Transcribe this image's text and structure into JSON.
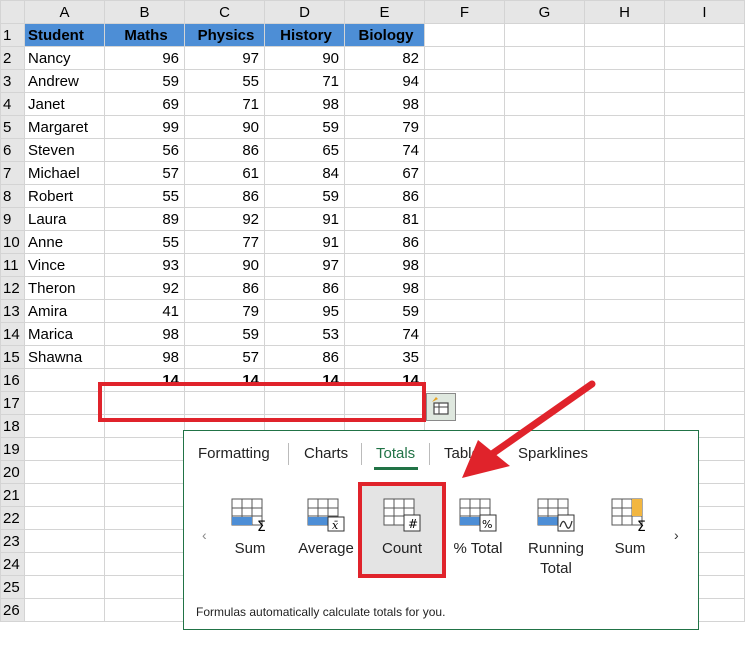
{
  "columns": [
    "A",
    "B",
    "C",
    "D",
    "E",
    "F",
    "G",
    "H",
    "I"
  ],
  "headers": [
    "Student",
    "Maths",
    "Physics",
    "History",
    "Biology"
  ],
  "rows": [
    {
      "name": "Nancy",
      "v": [
        "96",
        "97",
        "90",
        "82"
      ]
    },
    {
      "name": "Andrew",
      "v": [
        "59",
        "55",
        "71",
        "94"
      ]
    },
    {
      "name": "Janet",
      "v": [
        "69",
        "71",
        "98",
        "98"
      ]
    },
    {
      "name": "Margaret",
      "v": [
        "99",
        "90",
        "59",
        "79"
      ]
    },
    {
      "name": "Steven",
      "v": [
        "56",
        "86",
        "65",
        "74"
      ]
    },
    {
      "name": "Michael",
      "v": [
        "57",
        "61",
        "84",
        "67"
      ]
    },
    {
      "name": "Robert",
      "v": [
        "55",
        "86",
        "59",
        "86"
      ]
    },
    {
      "name": "Laura",
      "v": [
        "89",
        "92",
        "91",
        "81"
      ]
    },
    {
      "name": "Anne",
      "v": [
        "55",
        "77",
        "91",
        "86"
      ]
    },
    {
      "name": "Vince",
      "v": [
        "93",
        "90",
        "97",
        "98"
      ]
    },
    {
      "name": "Theron",
      "v": [
        "92",
        "86",
        "86",
        "98"
      ]
    },
    {
      "name": "Amira",
      "v": [
        "41",
        "79",
        "95",
        "59"
      ]
    },
    {
      "name": "Marica",
      "v": [
        "98",
        "59",
        "53",
        "74"
      ]
    },
    {
      "name": "Shawna",
      "v": [
        "98",
        "57",
        "86",
        "35"
      ]
    }
  ],
  "totals": [
    "14",
    "14",
    "14",
    "14"
  ],
  "row_numbers": [
    "1",
    "2",
    "3",
    "4",
    "5",
    "6",
    "7",
    "8",
    "9",
    "10",
    "11",
    "12",
    "13",
    "14",
    "15",
    "16",
    "17",
    "18",
    "19",
    "20",
    "21",
    "22",
    "23",
    "24",
    "25",
    "26"
  ],
  "quick_analysis": {
    "tabs": [
      "Formatting",
      "Charts",
      "Totals",
      "Tables",
      "Sparklines"
    ],
    "active_tab": "Totals",
    "items": [
      "Sum",
      "Average",
      "Count",
      "% Total",
      "Running Total",
      "Sum"
    ],
    "selected_item": "Count",
    "description": "Formulas automatically calculate totals for you.",
    "prev_arrow": "‹",
    "next_arrow": "›"
  },
  "colors": {
    "header_fill": "#4d8ed6",
    "accent": "#217346",
    "highlight": "#e0232b"
  }
}
